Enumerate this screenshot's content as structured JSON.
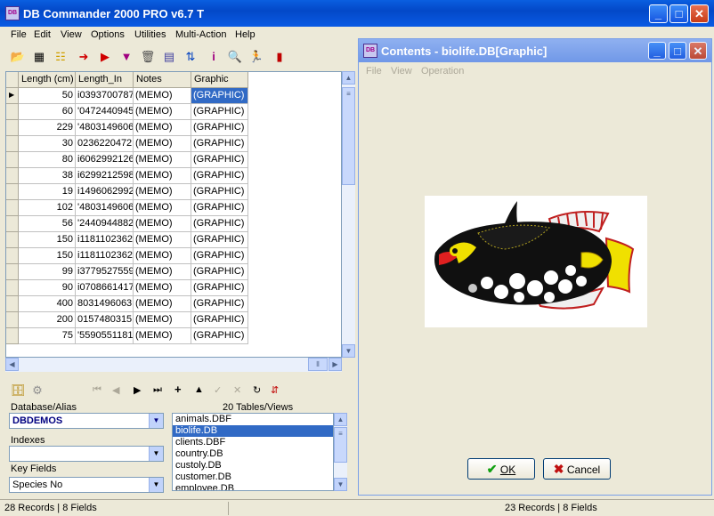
{
  "window": {
    "title": "DB Commander 2000 PRO v6.7 T",
    "app_icon_text": "DB"
  },
  "menu": [
    "File",
    "Edit",
    "View",
    "Options",
    "Utilities",
    "Multi-Action",
    "Help"
  ],
  "grid": {
    "columns": [
      "Length (cm)",
      "Length_In",
      "Notes",
      "Graphic"
    ],
    "rows": [
      [
        "50",
        "i0393700787",
        "(MEMO)",
        "(GRAPHIC)"
      ],
      [
        "60",
        "'0472440945",
        "(MEMO)",
        "(GRAPHIC)"
      ],
      [
        "229",
        "'4803149606",
        "(MEMO)",
        "(GRAPHIC)"
      ],
      [
        "30",
        "0236220472",
        "(MEMO)",
        "(GRAPHIC)"
      ],
      [
        "80",
        "i6062992126",
        "(MEMO)",
        "(GRAPHIC)"
      ],
      [
        "38",
        "i6299212598",
        "(MEMO)",
        "(GRAPHIC)"
      ],
      [
        "19",
        "i1496062992",
        "(MEMO)",
        "(GRAPHIC)"
      ],
      [
        "102",
        "'4803149606",
        "(MEMO)",
        "(GRAPHIC)"
      ],
      [
        "56",
        "'2440944882",
        "(MEMO)",
        "(GRAPHIC)"
      ],
      [
        "150",
        "i1181102362",
        "(MEMO)",
        "(GRAPHIC)"
      ],
      [
        "150",
        "i1181102362",
        "(MEMO)",
        "(GRAPHIC)"
      ],
      [
        "99",
        "i3779527559",
        "(MEMO)",
        "(GRAPHIC)"
      ],
      [
        "90",
        "i0708661417",
        "(MEMO)",
        "(GRAPHIC)"
      ],
      [
        "400",
        "8031496063",
        "(MEMO)",
        "(GRAPHIC)"
      ],
      [
        "200",
        "0157480315",
        "(MEMO)",
        "(GRAPHIC)"
      ],
      [
        "75",
        "'5590551181",
        "(MEMO)",
        "(GRAPHIC)"
      ]
    ]
  },
  "panel": {
    "database_label": "Database/Alias",
    "database_value": "DBDEMOS",
    "tables_label": "20 Tables/Views",
    "indexes_label": "Indexes",
    "indexes_value": "",
    "keyfields_label": "Key Fields",
    "keyfields_value": "Species No",
    "tables": [
      "animals.DBF",
      "biolife.DB",
      "clients.DBF",
      "country.DB",
      "custoly.DB",
      "customer.DB",
      "employee.DB"
    ],
    "selected_table": "biolife.DB"
  },
  "status": {
    "left": "28 Records | 8 Fields",
    "right": "23 Records | 8 Fields"
  },
  "contents": {
    "title": "Contents - biolife.DB[Graphic]",
    "menu": [
      "File",
      "View",
      "Operation"
    ],
    "ok_label": "OK",
    "cancel_label": "Cancel"
  },
  "colors": {
    "titlebar": "#0348c8",
    "selection": "#316ac5",
    "fish_body": "#101010",
    "fish_accent": "#f0e000"
  }
}
